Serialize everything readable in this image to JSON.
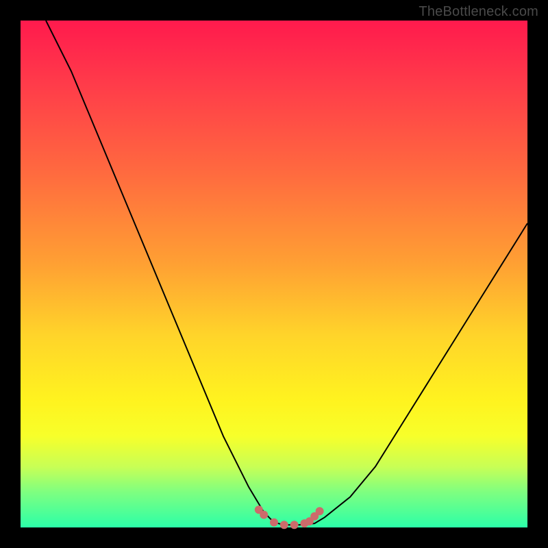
{
  "source_label": "TheBottleneck.com",
  "colors": {
    "gradient_top": "#ff1a4d",
    "gradient_bottom": "#2bffa8",
    "curve": "#000000",
    "markers": "#cc6b6b",
    "frame": "#000000"
  },
  "chart_data": {
    "type": "line",
    "title": "",
    "xlabel": "",
    "ylabel": "",
    "xlim": [
      0,
      100
    ],
    "ylim": [
      0,
      100
    ],
    "grid": false,
    "legend": false,
    "series": [
      {
        "name": "bottleneck-curve",
        "x": [
          5,
          10,
          15,
          20,
          25,
          30,
          35,
          40,
          45,
          48,
          50,
          52,
          55,
          58,
          60,
          65,
          70,
          75,
          80,
          85,
          90,
          95,
          100
        ],
        "y": [
          100,
          90,
          78,
          66,
          54,
          42,
          30,
          18,
          8,
          3,
          1,
          0.5,
          0.5,
          0.8,
          2,
          6,
          12,
          20,
          28,
          36,
          44,
          52,
          60
        ]
      }
    ],
    "markers": {
      "name": "highlight-points",
      "x": [
        47,
        48,
        50,
        52,
        54,
        56,
        57,
        58,
        59
      ],
      "y": [
        3.5,
        2.5,
        1,
        0.5,
        0.5,
        0.8,
        1.2,
        2.2,
        3.2
      ]
    }
  }
}
